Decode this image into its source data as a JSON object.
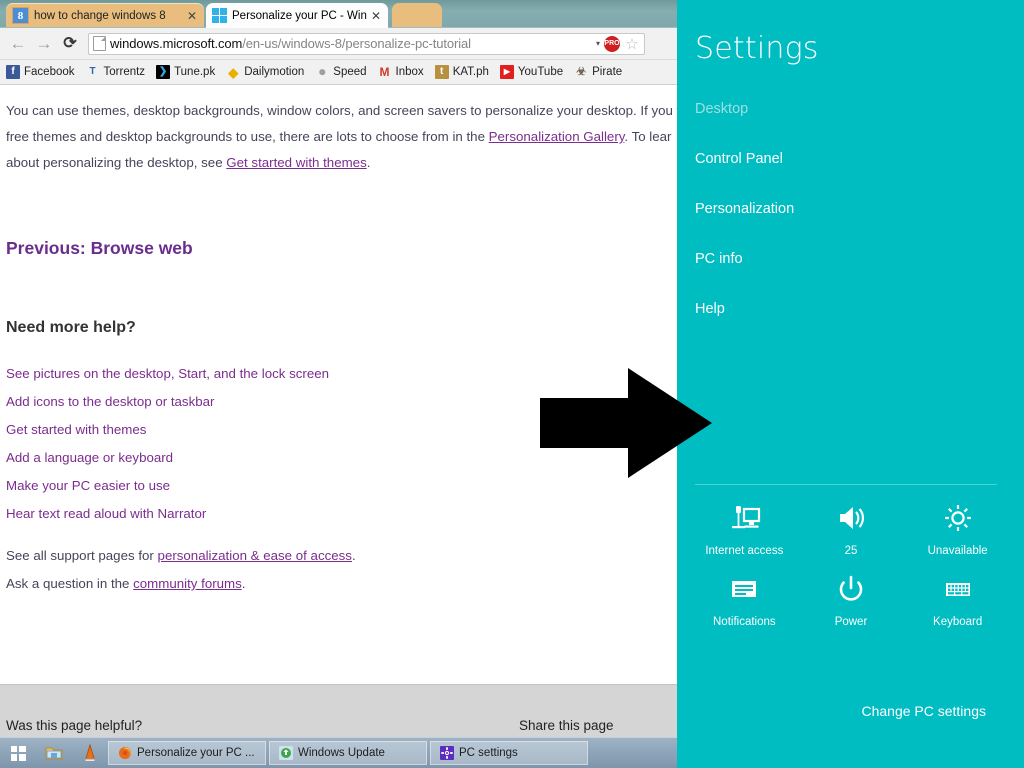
{
  "browser": {
    "tabs": [
      {
        "title": "how to change windows 8",
        "favicon": "google-icon",
        "active": false
      },
      {
        "title": "Personalize your PC - Win",
        "favicon": "windows-icon",
        "active": true
      }
    ],
    "nav": {
      "back": "←",
      "forward": "→",
      "reload": "⟳"
    },
    "omnibox": {
      "host": "windows.microsoft.com",
      "path": "/en-us/windows-8/personalize-pc-tutorial",
      "page_icon": "page-icon",
      "dropdown": "▾",
      "extension_badge": "PRO",
      "bookmark_star": "☆"
    },
    "bookmarks": [
      {
        "label": "Facebook",
        "icon_letter": "f",
        "icon_color": "#3b5998"
      },
      {
        "label": "Torrentz",
        "icon_letter": "T",
        "icon_color": "#ffffff"
      },
      {
        "label": "Tune.pk",
        "icon_letter": "❯",
        "icon_color": "#000000"
      },
      {
        "label": "Dailymotion",
        "icon_letter": "❙",
        "icon_color": "#f5c518"
      },
      {
        "label": "Speed",
        "icon_letter": "◌",
        "icon_color": "#9aa0a6"
      },
      {
        "label": "Inbox",
        "icon_letter": "M",
        "icon_color": "#ffffff"
      },
      {
        "label": "KAT.ph",
        "icon_letter": "t",
        "icon_color": "#b89040"
      },
      {
        "label": "YouTube",
        "icon_letter": "▶",
        "icon_color": "#e02020"
      },
      {
        "label": "Pirate",
        "icon_letter": "☠",
        "icon_color": "#6b5b4a"
      }
    ]
  },
  "page": {
    "intro_lines": [
      {
        "pre": "You can use themes, desktop backgrounds, window colors, and screen savers to personalize your desktop. If you w",
        "link": "",
        "post": ""
      },
      {
        "pre": "free themes and desktop backgrounds to use, there are lots to choose from in the ",
        "link": "Personalization Gallery",
        "post": ". To lear"
      },
      {
        "pre": "about personalizing the desktop, see ",
        "link": "Get started with themes",
        "post": "."
      }
    ],
    "previous_link": "Previous: Browse web",
    "need_help_heading": "Need more help?",
    "help_links": [
      "See pictures on the desktop, Start, and the lock screen",
      "Add icons to the desktop or taskbar",
      "Get started with themes",
      "Add a language or keyboard",
      "Make your PC easier to use",
      "Hear text read aloud with Narrator"
    ],
    "support_line": {
      "pre": "See all support pages for ",
      "link": "personalization & ease of access",
      "post": "."
    },
    "forum_line": {
      "pre": "Ask a question in the ",
      "link": "community forums",
      "post": "."
    },
    "feedback_prompt": "Was this page helpful?",
    "share_label": "Share this page"
  },
  "annotation": {
    "arrow": "right-arrow"
  },
  "charm": {
    "title": "Settings",
    "accent_color": "#00bdc2",
    "items": [
      {
        "label": "Desktop",
        "dim": true
      },
      {
        "label": "Control Panel",
        "dim": false
      },
      {
        "label": "Personalization",
        "dim": false
      },
      {
        "label": "PC info",
        "dim": false
      },
      {
        "label": "Help",
        "dim": false
      }
    ],
    "quick_settings": [
      {
        "icon": "network-icon",
        "label": "Internet access"
      },
      {
        "icon": "volume-icon",
        "label": "25"
      },
      {
        "icon": "brightness-icon",
        "label": "Unavailable"
      },
      {
        "icon": "notifications-icon",
        "label": "Notifications"
      },
      {
        "icon": "power-icon",
        "label": "Power"
      },
      {
        "icon": "keyboard-icon",
        "label": "Keyboard"
      }
    ],
    "change_pc_settings": "Change PC settings"
  },
  "taskbar": {
    "start": "start-button",
    "quick_launch": [
      {
        "name": "file-explorer-icon"
      },
      {
        "name": "vlc-icon"
      }
    ],
    "windows": [
      {
        "label": "Personalize your PC ...",
        "icon": "firefox-icon"
      },
      {
        "label": "Windows Update",
        "icon": "windows-update-icon"
      },
      {
        "label": "PC settings",
        "icon": "pc-settings-icon"
      }
    ]
  }
}
